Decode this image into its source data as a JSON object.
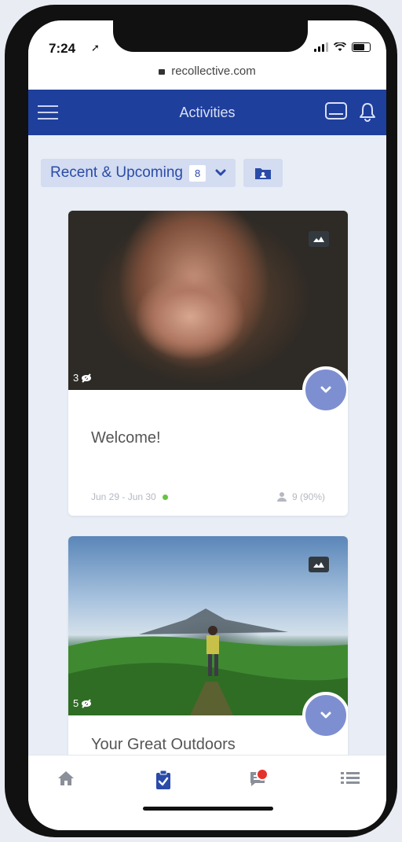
{
  "status": {
    "time": "7:24"
  },
  "browser": {
    "url": "recollective.com"
  },
  "topnav": {
    "title": "Activities"
  },
  "filter": {
    "label": "Recent & Upcoming",
    "count": "8"
  },
  "cards": [
    {
      "title": "Welcome!",
      "views": "3",
      "dates": "Jun 29 - Jun 30",
      "participants": "9 (90%)"
    },
    {
      "title": "Your Great Outdoors",
      "views": "5"
    }
  ],
  "colors": {
    "nav": "#1f3f9c",
    "accent": "#2a4ba8",
    "expand": "#7e8fd1",
    "status_active": "#63c541",
    "notification": "#e4322b"
  },
  "bottom_tabs": [
    {
      "icon": "home-icon"
    },
    {
      "icon": "activities-icon",
      "active": true
    },
    {
      "icon": "messages-icon",
      "has_notification": true
    },
    {
      "icon": "list-icon"
    }
  ]
}
